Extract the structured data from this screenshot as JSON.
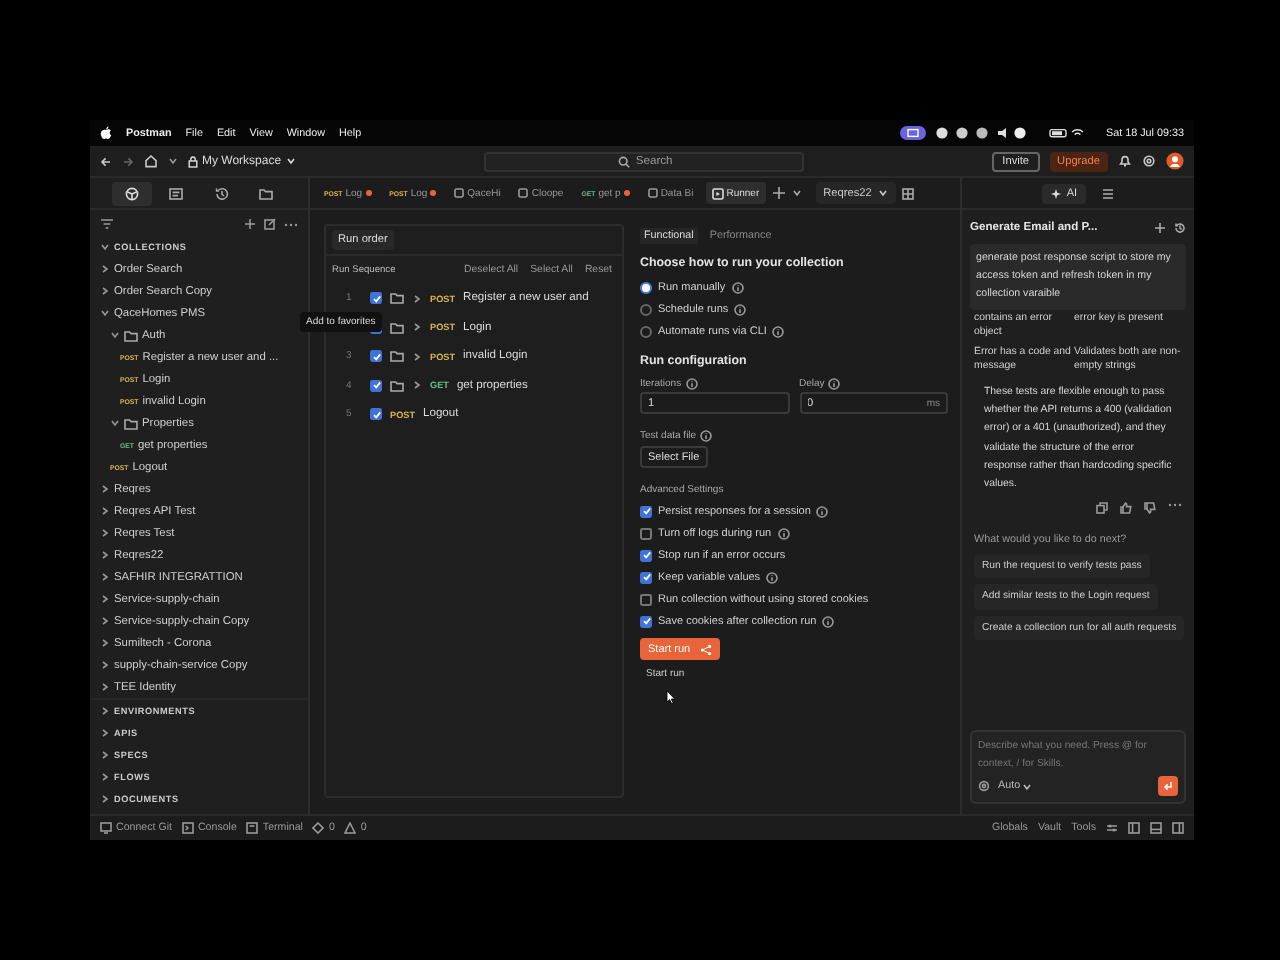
{
  "menubar": {
    "app": "Postman",
    "menus": [
      "File",
      "Edit",
      "View",
      "Window",
      "Help"
    ],
    "clock": "Sat 18 Jul 09:33"
  },
  "header": {
    "workspace": "My Workspace",
    "search": {
      "placeholder": "Search"
    },
    "buttons": [
      {
        "label": "Invite",
        "kind": "outline"
      },
      {
        "label": "Upgrade",
        "kind": "accent"
      }
    ]
  },
  "sidebar": {
    "section": "COLLECTIONS",
    "collections": [
      {
        "label": "Order Search",
        "kind": "collection",
        "expanded": false
      },
      {
        "label": "Order Search Copy",
        "kind": "collection",
        "expanded": false
      },
      {
        "label": "QaceHomes PMS",
        "kind": "collection",
        "expanded": true,
        "children": [
          {
            "label": "Auth",
            "kind": "folder",
            "expanded": true,
            "children": [
              {
                "label": "Register a new user and ...",
                "kind": "request",
                "method": "POST"
              },
              {
                "label": "Login",
                "kind": "request",
                "method": "POST"
              },
              {
                "label": "invalid Login",
                "kind": "request",
                "method": "POST"
              }
            ]
          },
          {
            "label": "Properties",
            "kind": "folder",
            "expanded": true,
            "children": [
              {
                "label": "get properties",
                "kind": "request",
                "method": "GET"
              }
            ]
          },
          {
            "label": "Logout",
            "kind": "request",
            "method": "POST"
          }
        ]
      },
      {
        "label": "Reqres",
        "kind": "collection",
        "expanded": false
      },
      {
        "label": "Reqres API Test",
        "kind": "collection",
        "expanded": false
      },
      {
        "label": "Reqres Test",
        "kind": "collection",
        "expanded": false
      },
      {
        "label": "Reqres22",
        "kind": "collection",
        "expanded": false
      },
      {
        "label": "SAFHIR INTEGRATTION",
        "kind": "collection",
        "expanded": false
      },
      {
        "label": "Service-supply-chain",
        "kind": "collection",
        "expanded": false
      },
      {
        "label": "Service-supply-chain Copy",
        "kind": "collection",
        "expanded": false
      },
      {
        "label": "Sumiltech - Corona",
        "kind": "collection",
        "expanded": false
      },
      {
        "label": "supply-chain-service Copy",
        "kind": "collection",
        "expanded": false
      },
      {
        "label": "TEE Identity",
        "kind": "collection",
        "expanded": false
      }
    ],
    "sections": [
      "ENVIRONMENTS",
      "APIS",
      "SPECS",
      "FLOWS",
      "DOCUMENTS"
    ]
  },
  "tabs": [
    {
      "kind": "request",
      "method": "POST",
      "label": "Log",
      "unsaved": true,
      "selected": false
    },
    {
      "kind": "request",
      "method": "POST",
      "label": "Log",
      "unsaved": true,
      "selected": false
    },
    {
      "kind": "collection",
      "label": "QaceHi",
      "unsaved": false,
      "selected": false
    },
    {
      "kind": "collection",
      "label": "Cloope",
      "unsaved": false,
      "selected": false
    },
    {
      "kind": "request",
      "method": "GET",
      "label": "get p",
      "unsaved": true,
      "selected": false
    },
    {
      "kind": "collection",
      "label": "Data Bi",
      "unsaved": false,
      "selected": false
    },
    {
      "kind": "runner",
      "label": "Runner",
      "unsaved": false,
      "selected": true
    }
  ],
  "environment": "Reqres22",
  "run_order": {
    "title": "Run order",
    "heading": "Run Sequence",
    "actions": [
      "Deselect All",
      "Select All",
      "Reset"
    ],
    "rows": [
      {
        "index": "1",
        "checked": true,
        "folder": true,
        "method": "POST",
        "name": "Register a new user and"
      },
      {
        "checked": true,
        "folder": true,
        "method": "POST",
        "name": "Login"
      },
      {
        "index": "3",
        "checked": true,
        "folder": true,
        "method": "POST",
        "name": "invalid Login"
      },
      {
        "index": "4",
        "checked": true,
        "folder": true,
        "method": "GET",
        "name": "get properties"
      },
      {
        "index": "5",
        "checked": true,
        "folder": false,
        "method": "POST",
        "name": "Logout"
      }
    ]
  },
  "tooltip": "Add to favorites",
  "config": {
    "tabs": [
      {
        "label": "Functional",
        "selected": true
      },
      {
        "label": "Performance",
        "selected": false
      }
    ],
    "heading": "Choose how to run your collection",
    "run_modes": [
      {
        "label": "Run manually",
        "selected": true
      },
      {
        "label": "Schedule runs",
        "selected": false
      },
      {
        "label": "Automate runs via CLI",
        "selected": false
      }
    ],
    "section": "Run configuration",
    "iterations": {
      "label": "Iterations",
      "value": "1"
    },
    "delay": {
      "label": "Delay",
      "value": "0",
      "unit": "ms"
    },
    "data_file": {
      "label": "Test data file",
      "button": "Select File"
    },
    "advanced": {
      "title": "Advanced Settings",
      "options": [
        {
          "label": "Persist responses for a session",
          "checked": true,
          "info": true
        },
        {
          "label": "Turn off logs during run",
          "checked": false,
          "info": true
        },
        {
          "label": "Stop run if an error occurs",
          "checked": true,
          "info": false
        },
        {
          "label": "Keep variable values",
          "checked": true,
          "info": true
        },
        {
          "label": "Run collection without using stored cookies",
          "checked": false,
          "info": false
        },
        {
          "label": "Save cookies after collection run",
          "checked": true,
          "info": true
        }
      ]
    },
    "start_button": "Start run",
    "start_tooltip": "Start run"
  },
  "ai": {
    "button": "AI",
    "title": "Generate Email and P...",
    "prompt": "generate post response script to store my access token and refresh token in my collection varaible",
    "table": [
      [
        "contains an error object",
        "error key is present"
      ],
      [
        "Error has a code and message",
        "Validates both are non-empty strings"
      ]
    ],
    "summary": "These tests are flexible enough to pass whether the API returns a 400 (validation error) or a 401 (unauthorized), and they validate the structure of the error response rather than hardcoding specific values.",
    "next_title": "What would you like to do next?",
    "suggestions": [
      "Run the request to verify tests pass",
      "Add similar tests to the Login request",
      "Create a collection run for all auth requests"
    ],
    "composer": {
      "placeholder": "Describe what you need. Press @ for context, / for Skills.",
      "mode": "Auto"
    }
  },
  "status_bar": {
    "left": [
      {
        "kind": "git",
        "label": "Connect Git"
      },
      {
        "kind": "console",
        "label": "Console"
      },
      {
        "kind": "terminal",
        "label": "Terminal"
      }
    ],
    "errors": "0",
    "warnings": "0",
    "right": [
      "Globals",
      "Vault",
      "Tools"
    ]
  }
}
